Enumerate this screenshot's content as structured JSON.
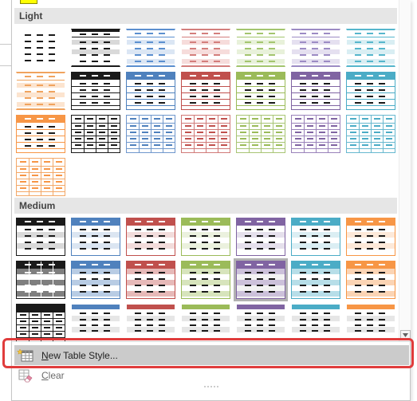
{
  "sections": {
    "light": "Light",
    "medium": "Medium"
  },
  "light_styles": [
    {
      "name": "light-1-none",
      "kind": "dash",
      "b": "#ffffff",
      "h": "none",
      "d": "#1a1a1a"
    },
    {
      "name": "light-1-black",
      "kind": "dark",
      "b": "#1a1a1a",
      "h": "#1a1a1a",
      "d": "#1a1a1a",
      "band": "#d9d9d9"
    },
    {
      "name": "light-1-blue",
      "kind": "bandh",
      "b": "#5b8fcf",
      "h": "none",
      "d": "#5b8fcf",
      "band": "#dbe6f4"
    },
    {
      "name": "light-1-red",
      "kind": "bandh",
      "b": "#d37e7c",
      "h": "none",
      "d": "#d37e7c",
      "band": "#f6dcdb"
    },
    {
      "name": "light-1-green",
      "kind": "bandh",
      "b": "#a3c56e",
      "h": "none",
      "d": "#a3c56e",
      "band": "#e8f1da"
    },
    {
      "name": "light-1-purple",
      "kind": "bandh",
      "b": "#9c8bc4",
      "h": "none",
      "d": "#9c8bc4",
      "band": "#e5e0f0"
    },
    {
      "name": "light-1-aqua",
      "kind": "bandh",
      "b": "#56b6cc",
      "h": "none",
      "d": "#56b6cc",
      "band": "#d9eef3"
    },
    {
      "name": "light-2-orange",
      "kind": "bandh",
      "b": "#f0a35e",
      "h": "none",
      "d": "#f0a35e",
      "band": "#fce4cf"
    },
    {
      "name": "light-2-black",
      "kind": "outline",
      "b": "#1a1a1a",
      "h": "#1a1a1a",
      "d": "#1a1a1a"
    },
    {
      "name": "light-2-blue",
      "kind": "outline",
      "b": "#4f81bd",
      "h": "#4f81bd",
      "d": "#4f81bd"
    },
    {
      "name": "light-2-red",
      "kind": "outline",
      "b": "#c0504d",
      "h": "#c0504d",
      "d": "#c0504d"
    },
    {
      "name": "light-2-green",
      "kind": "outline",
      "b": "#9bbb59",
      "h": "#9bbb59",
      "d": "#9bbb59"
    },
    {
      "name": "light-2-purple",
      "kind": "outline",
      "b": "#8064a2",
      "h": "#8064a2",
      "d": "#8064a2"
    },
    {
      "name": "light-2-aqua",
      "kind": "outline",
      "b": "#4bacc6",
      "h": "#4bacc6",
      "d": "#4bacc6"
    },
    {
      "name": "light-3-orange",
      "kind": "outline",
      "b": "#f79646",
      "h": "#f79646",
      "d": "#f79646"
    },
    {
      "name": "light-3-black",
      "kind": "grid",
      "b": "#1a1a1a",
      "h": "none",
      "d": "#1a1a1a"
    },
    {
      "name": "light-3-blue",
      "kind": "grid",
      "b": "#6f97cc",
      "h": "none",
      "d": "#4f81bd"
    },
    {
      "name": "light-3-red",
      "kind": "grid",
      "b": "#d07a78",
      "h": "none",
      "d": "#c0504d"
    },
    {
      "name": "light-3-green",
      "kind": "grid",
      "b": "#a8c574",
      "h": "none",
      "d": "#9bbb59"
    },
    {
      "name": "light-3-purple",
      "kind": "grid",
      "b": "#9a82ba",
      "h": "none",
      "d": "#8064a2"
    },
    {
      "name": "light-3-aqua",
      "kind": "grid",
      "b": "#67b8cf",
      "h": "none",
      "d": "#4bacc6"
    },
    {
      "name": "light-4-orange",
      "kind": "grid",
      "b": "#f3a868",
      "h": "none",
      "d": "#f79646"
    }
  ],
  "medium_styles": [
    {
      "name": "medium-1-black",
      "kind": "med",
      "b": "#1a1a1a",
      "h": "#1a1a1a",
      "d": "#1a1a1a",
      "band": "#d9d9d9"
    },
    {
      "name": "medium-1-blue",
      "kind": "med",
      "b": "#4f81bd",
      "h": "#4f81bd",
      "d": "#1a1a1a",
      "band": "#dbe5f1"
    },
    {
      "name": "medium-1-red",
      "kind": "med",
      "b": "#c0504d",
      "h": "#c0504d",
      "d": "#1a1a1a",
      "band": "#f2dcdb"
    },
    {
      "name": "medium-1-green",
      "kind": "med",
      "b": "#9bbb59",
      "h": "#9bbb59",
      "d": "#1a1a1a",
      "band": "#ebf1de"
    },
    {
      "name": "medium-1-purple",
      "kind": "med",
      "b": "#8064a2",
      "h": "#8064a2",
      "d": "#1a1a1a",
      "band": "#e5e0ec"
    },
    {
      "name": "medium-1-aqua",
      "kind": "med",
      "b": "#4bacc6",
      "h": "#4bacc6",
      "d": "#1a1a1a",
      "band": "#dbeef3"
    },
    {
      "name": "medium-1-orange",
      "kind": "med",
      "b": "#f79646",
      "h": "#f79646",
      "d": "#1a1a1a",
      "band": "#fde9d9"
    },
    {
      "name": "medium-2-black",
      "kind": "med2",
      "b": "#1a1a1a",
      "h": "#1a1a1a",
      "d": "#ffffff",
      "band": "#bfbfbf"
    },
    {
      "name": "medium-2-blue",
      "kind": "med2",
      "b": "#4f81bd",
      "h": "#4f81bd",
      "d": "#1a1a1a",
      "band": "#b8cce4"
    },
    {
      "name": "medium-2-red",
      "kind": "med2",
      "b": "#c0504d",
      "h": "#c0504d",
      "d": "#1a1a1a",
      "band": "#e6b9b8"
    },
    {
      "name": "medium-2-green",
      "kind": "med2",
      "b": "#9bbb59",
      "h": "#9bbb59",
      "d": "#1a1a1a",
      "band": "#d7e4bc"
    },
    {
      "name": "medium-2-purple",
      "kind": "med2",
      "b": "#8064a2",
      "h": "#8064a2",
      "d": "#1a1a1a",
      "band": "#ccc1da",
      "selected": true
    },
    {
      "name": "medium-2-aqua",
      "kind": "med2",
      "b": "#4bacc6",
      "h": "#4bacc6",
      "d": "#1a1a1a",
      "band": "#b7dee8"
    },
    {
      "name": "medium-2-orange",
      "kind": "med2",
      "b": "#f79646",
      "h": "#f79646",
      "d": "#1a1a1a",
      "band": "#fbd4b4"
    },
    {
      "name": "medium-3-black",
      "kind": "med3",
      "b": "#1a1a1a",
      "h": "#1a1a1a",
      "d": "#1a1a1a",
      "band": "#a6a6a6"
    },
    {
      "name": "medium-3-blue",
      "kind": "med4",
      "b": "#4f81bd",
      "h": "#4f81bd",
      "d": "#1a1a1a",
      "band": "#e0e0e0"
    },
    {
      "name": "medium-3-red",
      "kind": "med4",
      "b": "#c0504d",
      "h": "#c0504d",
      "d": "#1a1a1a",
      "band": "#e0e0e0"
    },
    {
      "name": "medium-3-green",
      "kind": "med4",
      "b": "#9bbb59",
      "h": "#9bbb59",
      "d": "#1a1a1a",
      "band": "#e0e0e0"
    },
    {
      "name": "medium-3-purple",
      "kind": "med4",
      "b": "#8064a2",
      "h": "#8064a2",
      "d": "#1a1a1a",
      "band": "#e0e0e0"
    },
    {
      "name": "medium-3-aqua",
      "kind": "med4",
      "b": "#4bacc6",
      "h": "#4bacc6",
      "d": "#1a1a1a",
      "band": "#e0e0e0"
    },
    {
      "name": "medium-3-orange",
      "kind": "med4",
      "b": "#f79646",
      "h": "#f79646",
      "d": "#1a1a1a",
      "band": "#e0e0e0"
    }
  ],
  "menu": {
    "new_table_style": "New Table Style...",
    "new_table_style_icon": "new-table-style-icon",
    "clear": "Clear",
    "clear_icon": "eraser-icon"
  },
  "colors": {
    "highlight": "#e03c3c",
    "hover": "#cbcbcb"
  }
}
